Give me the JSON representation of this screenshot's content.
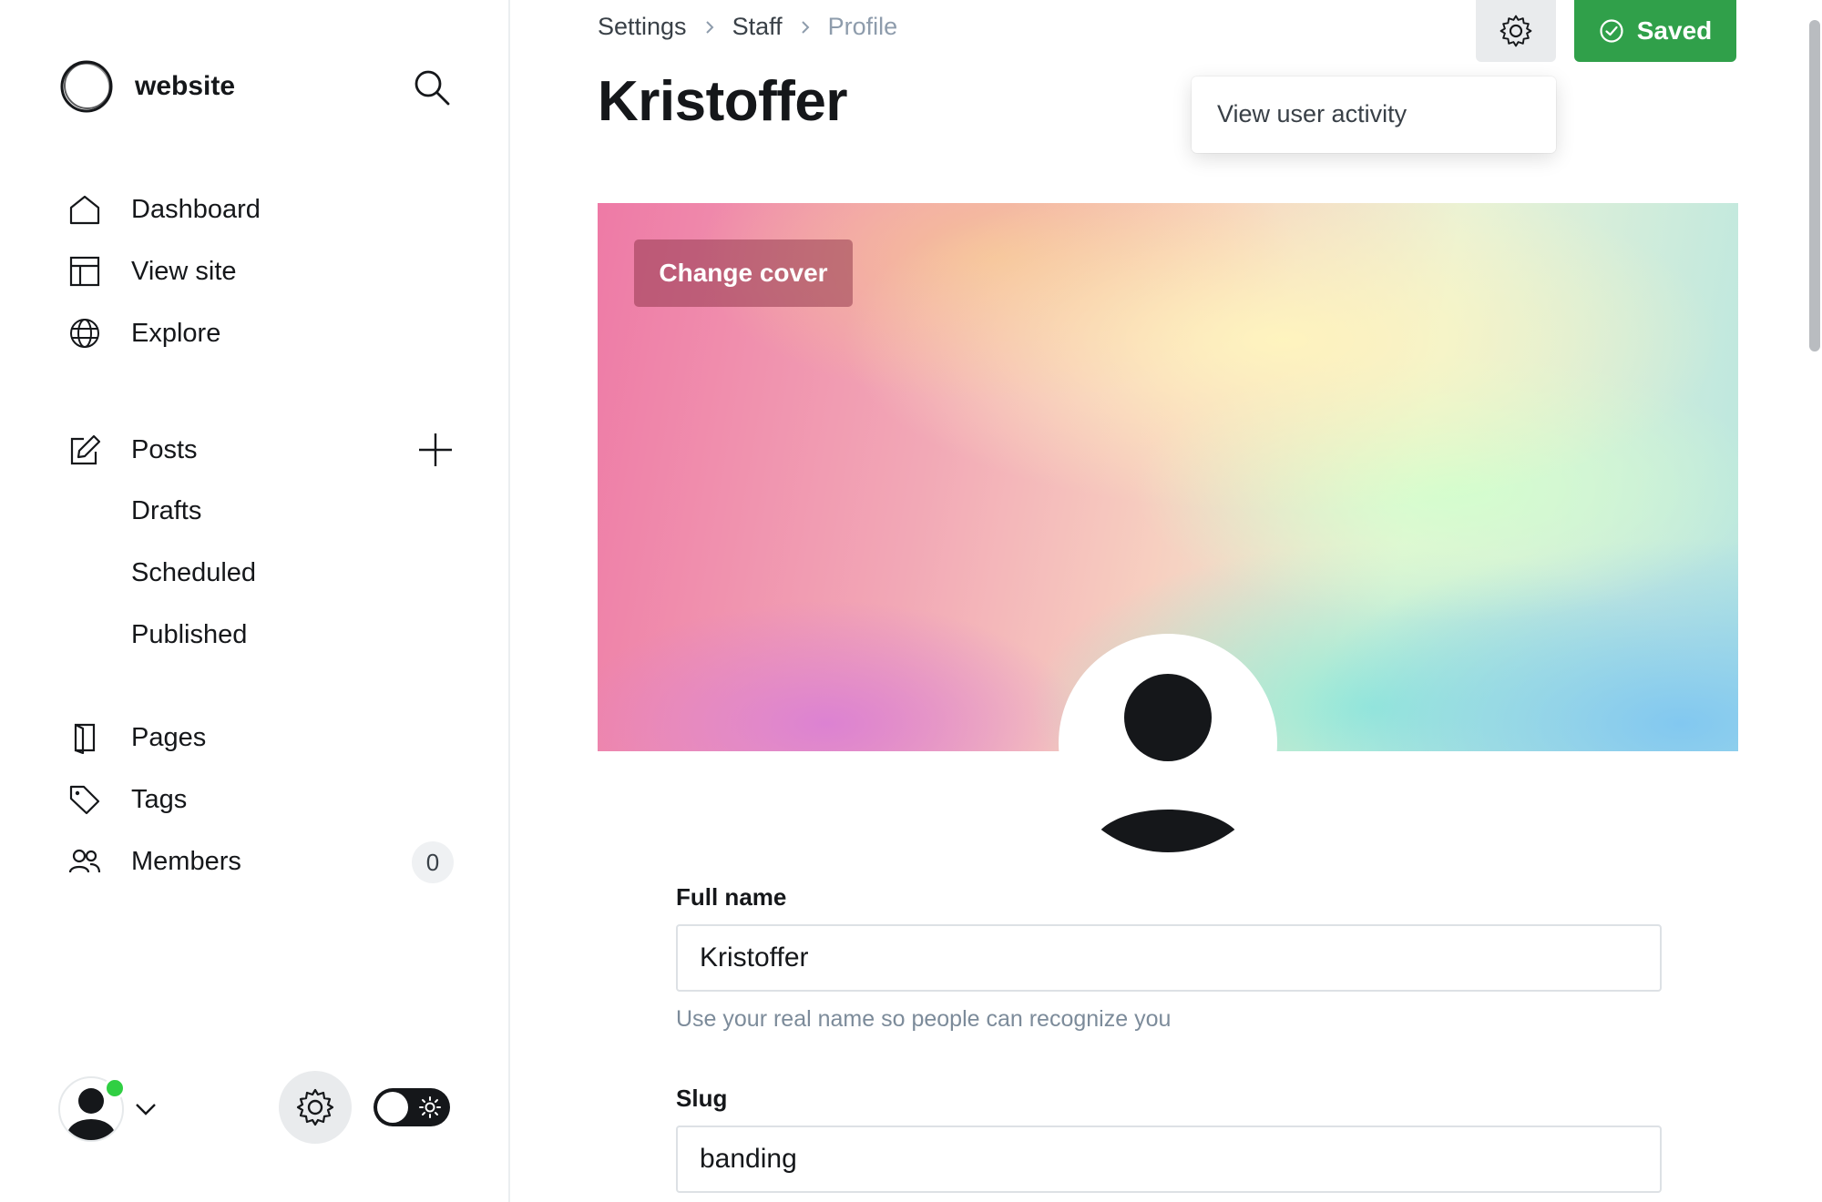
{
  "sidebar": {
    "brand": "website",
    "nav": [
      {
        "label": "Dashboard",
        "icon": "home-icon"
      },
      {
        "label": "View site",
        "icon": "layout-icon"
      },
      {
        "label": "Explore",
        "icon": "globe-icon"
      }
    ],
    "posts": {
      "label": "Posts",
      "icon": "edit-icon",
      "sub": [
        "Drafts",
        "Scheduled",
        "Published"
      ]
    },
    "secondary": [
      {
        "label": "Pages",
        "icon": "book-icon"
      },
      {
        "label": "Tags",
        "icon": "tag-icon"
      },
      {
        "label": "Members",
        "icon": "users-icon",
        "count": "0"
      }
    ]
  },
  "header": {
    "breadcrumb": [
      "Settings",
      "Staff",
      "Profile"
    ],
    "title": "Kristoffer",
    "saved_label": "Saved",
    "dropdown_item": "View user activity"
  },
  "cover": {
    "change_label": "Change cover"
  },
  "form": {
    "full_name": {
      "label": "Full name",
      "value": "Kristoffer",
      "help": "Use your real name so people can recognize you"
    },
    "slug": {
      "label": "Slug",
      "value": "banding"
    }
  },
  "colors": {
    "accent_green": "#30a04a",
    "status_online": "#30cf43",
    "text_dark": "#15171a",
    "muted": "#8e9cac"
  }
}
